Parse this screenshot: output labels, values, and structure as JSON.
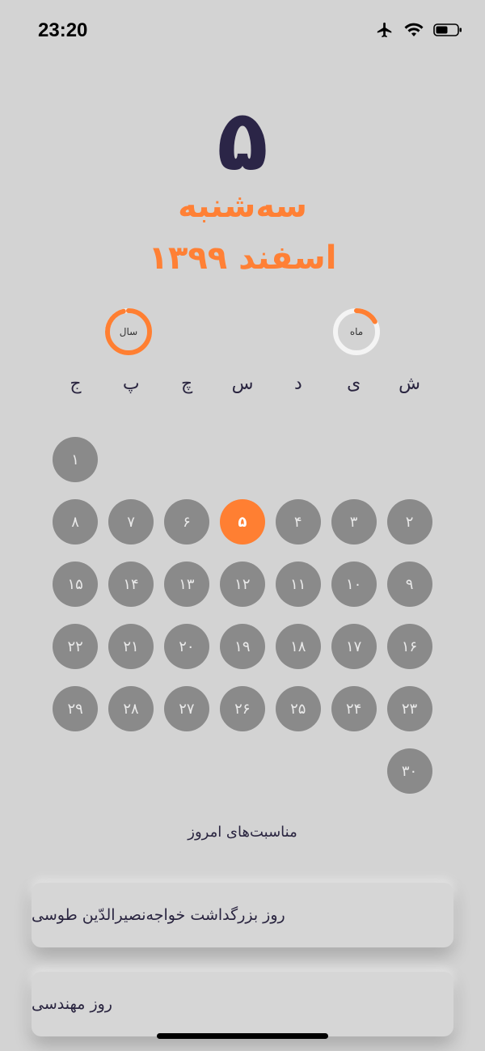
{
  "status_bar": {
    "time": "23:20",
    "icons": [
      "airplane-icon",
      "wifi-icon",
      "battery-icon"
    ]
  },
  "header": {
    "day_number": "۵",
    "weekday": "سه‌شنبه",
    "month_year": "اسفند ۱۳۹۹"
  },
  "progress": {
    "year": {
      "label": "سال",
      "fraction": 0.96
    },
    "month": {
      "label": "ماه",
      "fraction": 0.17
    }
  },
  "weekdays": [
    "ش",
    "ی",
    "د",
    "س",
    "چ",
    "پ",
    "ج"
  ],
  "calendar": {
    "days": [
      "۱",
      "۲",
      "۳",
      "۴",
      "۵",
      "۶",
      "۷",
      "۸",
      "۹",
      "۱۰",
      "۱۱",
      "۱۲",
      "۱۳",
      "۱۴",
      "۱۵",
      "۱۶",
      "۱۷",
      "۱۸",
      "۱۹",
      "۲۰",
      "۲۱",
      "۲۲",
      "۲۳",
      "۲۴",
      "۲۵",
      "۲۶",
      "۲۷",
      "۲۸",
      "۲۹",
      "۳۰"
    ],
    "today": "۵"
  },
  "occasions": {
    "heading": "مناسبت‌های امروز",
    "items": [
      "روز بزرگداشت خواجه‌نصیرالدّین طوسی",
      "روز مهندسی"
    ]
  },
  "colors": {
    "accent": "#ff7f32",
    "title": "#2b2547",
    "day_circle": "#8a8a8a",
    "background": "#d3d3d3"
  }
}
